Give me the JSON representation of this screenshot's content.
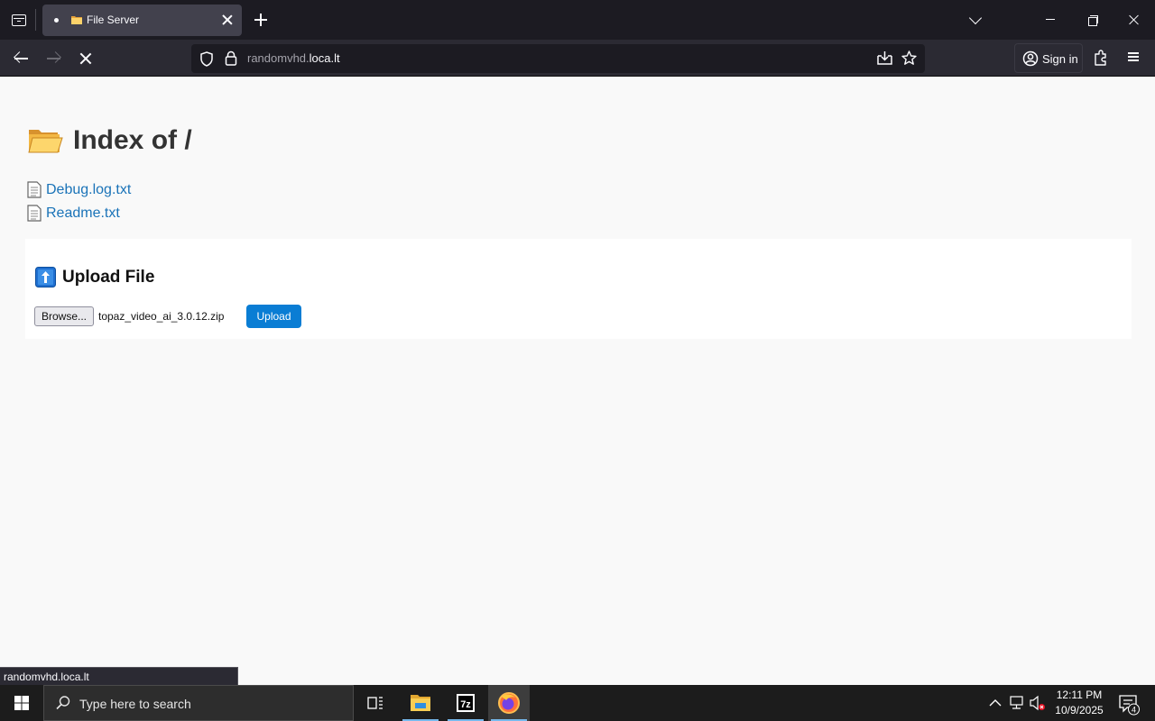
{
  "browser": {
    "tab_title": "File Server",
    "url_subdomain": "randomvhd.",
    "url_domain": "loca.lt",
    "signin_label": "Sign in",
    "status_url": "randomvhd.loca.lt"
  },
  "page": {
    "title": "Index of /",
    "files": [
      {
        "name": "Debug.log.txt"
      },
      {
        "name": "Readme.txt"
      }
    ],
    "upload": {
      "heading": "Upload File",
      "browse_label": "Browse...",
      "selected_file": "topaz_video_ai_3.0.12.zip",
      "submit_label": "Upload"
    }
  },
  "taskbar": {
    "search_placeholder": "Type here to search",
    "time": "12:11 PM",
    "date": "10/9/2025",
    "notification_count": "4"
  },
  "colors": {
    "link": "#1a73b8",
    "upload_button": "#0a7dd4",
    "browser_toolbar": "#2b2a33",
    "tab_strip": "#1c1b22"
  },
  "icons": {
    "tab_favicon": "folder-icon",
    "heading": "open-folder-icon",
    "file": "document-icon",
    "upload": "up-arrow-icon"
  }
}
